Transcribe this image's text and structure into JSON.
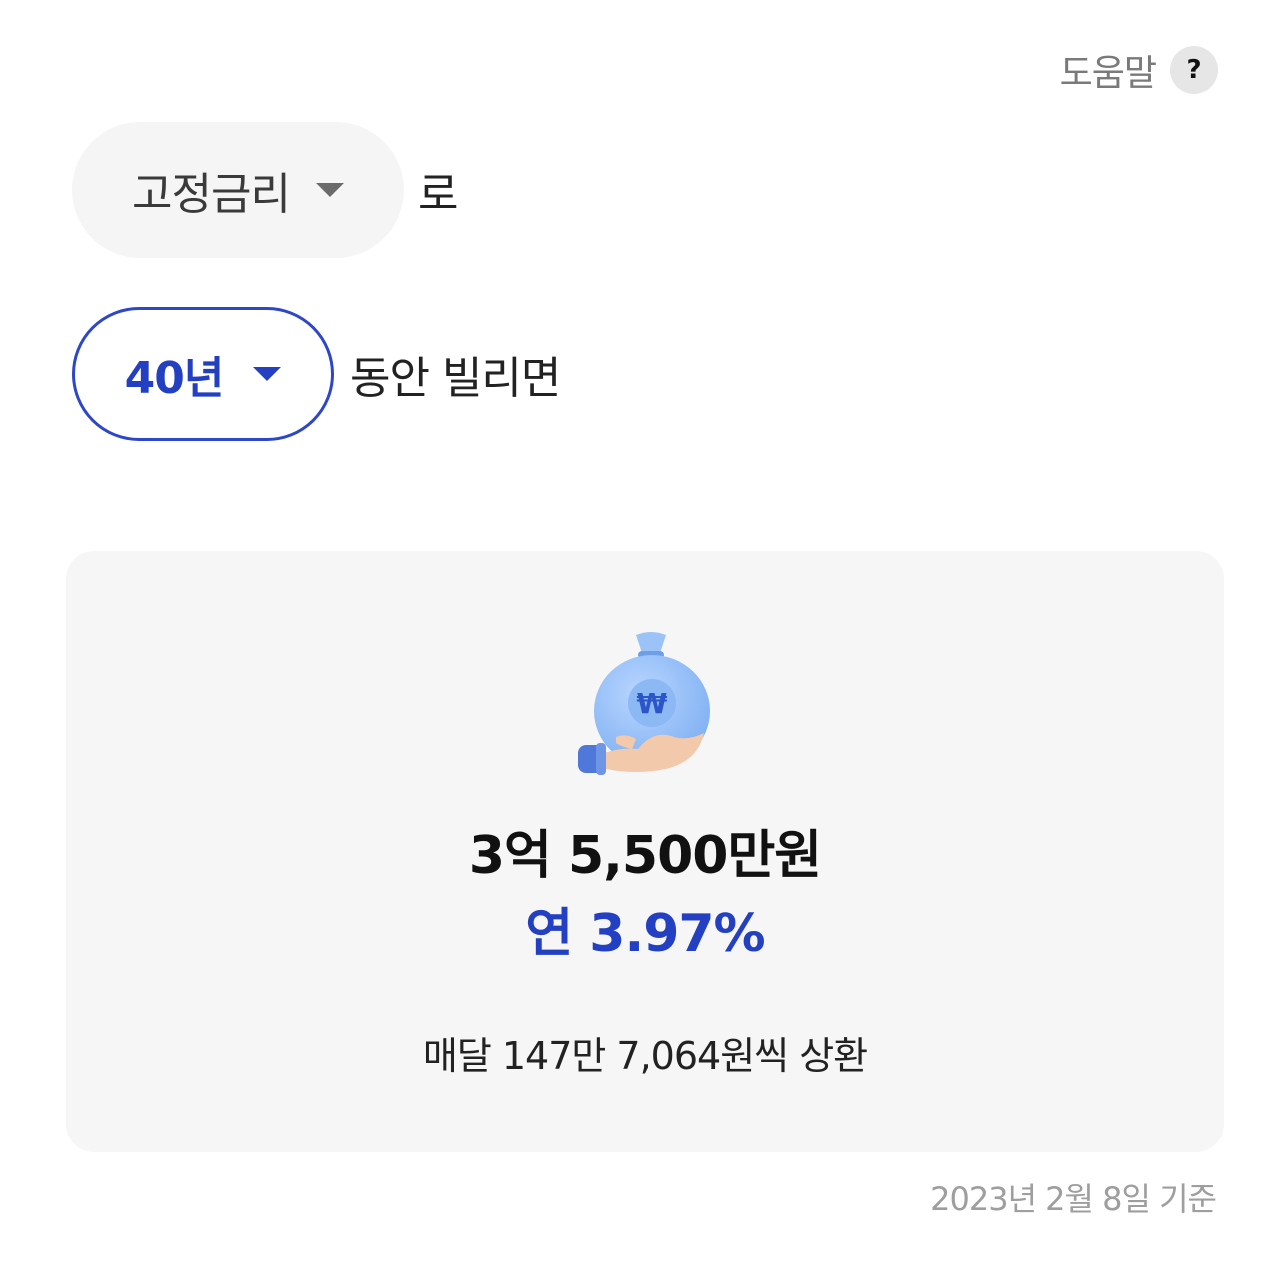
{
  "help": {
    "label": "도움말",
    "icon_glyph": "?"
  },
  "rate_type": {
    "selected": "고정금리",
    "suffix": "로"
  },
  "loan_term": {
    "selected": "40년",
    "suffix": "동안 빌리면"
  },
  "result": {
    "amount": "3억 5,500만원",
    "rate": "연 3.97%",
    "monthly": "매달 147만 7,064원씩 상환",
    "icon": "money-bag-hand-icon",
    "currency_symbol": "₩"
  },
  "basis_date": "2023년 2월 8일 기준",
  "colors": {
    "accent": "#2440c2",
    "card_bg": "#f6f6f6",
    "muted": "#9e9e9e"
  }
}
